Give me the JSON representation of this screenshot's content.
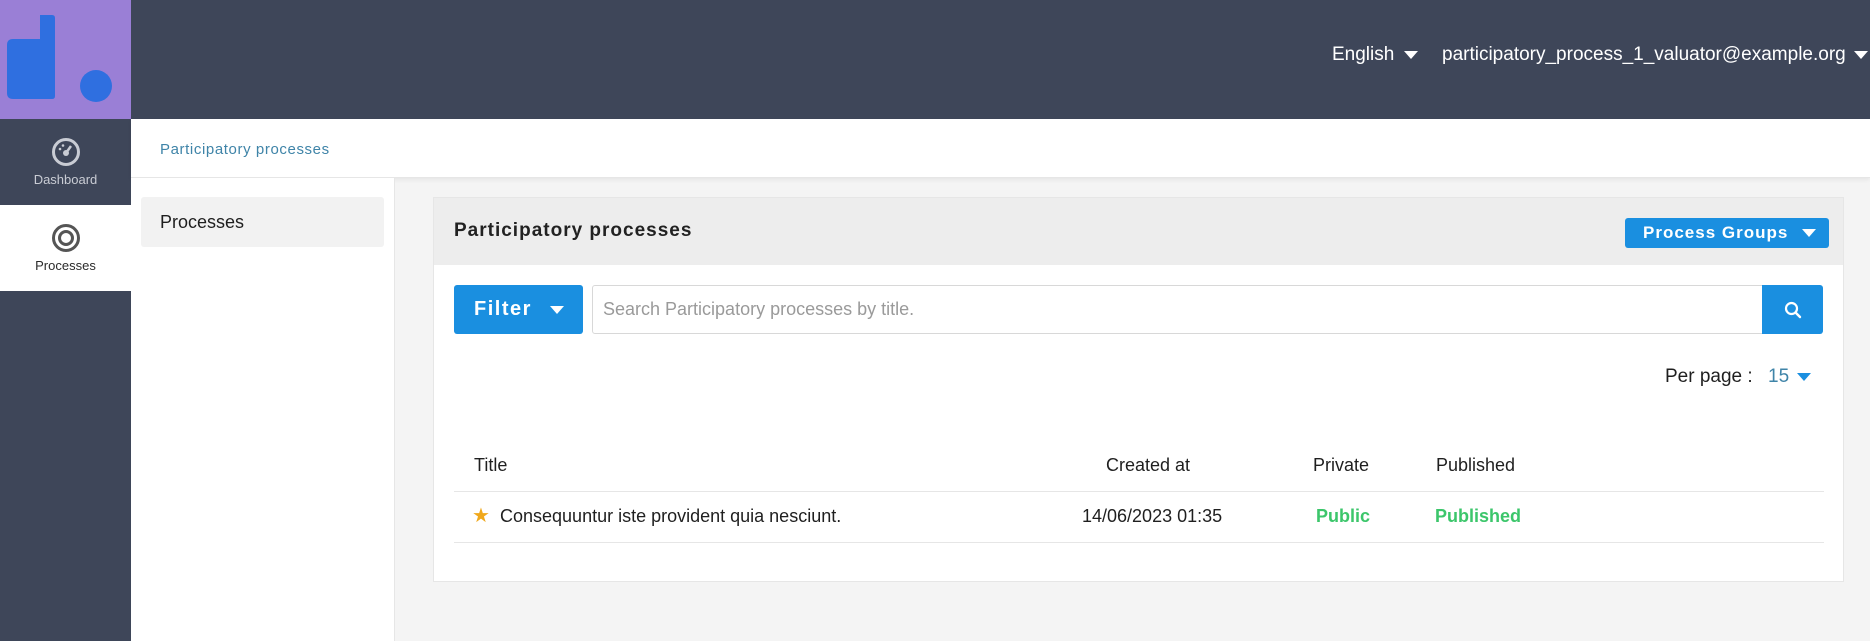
{
  "header": {
    "language": "English",
    "user_email": "participatory_process_1_valuator@example.org"
  },
  "sidebar": {
    "items": [
      {
        "label": "Dashboard",
        "icon": "dashboard-icon"
      },
      {
        "label": "Processes",
        "icon": "target-icon"
      }
    ]
  },
  "breadcrumb": {
    "label": "Participatory processes"
  },
  "subnav": {
    "items": [
      {
        "label": "Processes"
      }
    ]
  },
  "main": {
    "title": "Participatory processes",
    "groups_button": "Process Groups",
    "filter_button": "Filter",
    "search_placeholder": "Search Participatory processes by title.",
    "per_page_label": "Per page :",
    "per_page_value": "15",
    "table": {
      "columns": [
        "Title",
        "Created at",
        "Private",
        "Published"
      ],
      "rows": [
        {
          "title": "Consequuntur iste provident quia nesciunt.",
          "created_at": "14/06/2023 01:35",
          "private": "Public",
          "published": "Published",
          "highlighted": true
        }
      ]
    }
  },
  "colors": {
    "topbar": "#3e4659",
    "logo_bg": "#9a7fd6",
    "logo_mark": "#2f6fe0",
    "primary": "#1a8fe0",
    "link": "#3f84a8",
    "success": "#3cc66b",
    "star": "#f0a81c"
  }
}
